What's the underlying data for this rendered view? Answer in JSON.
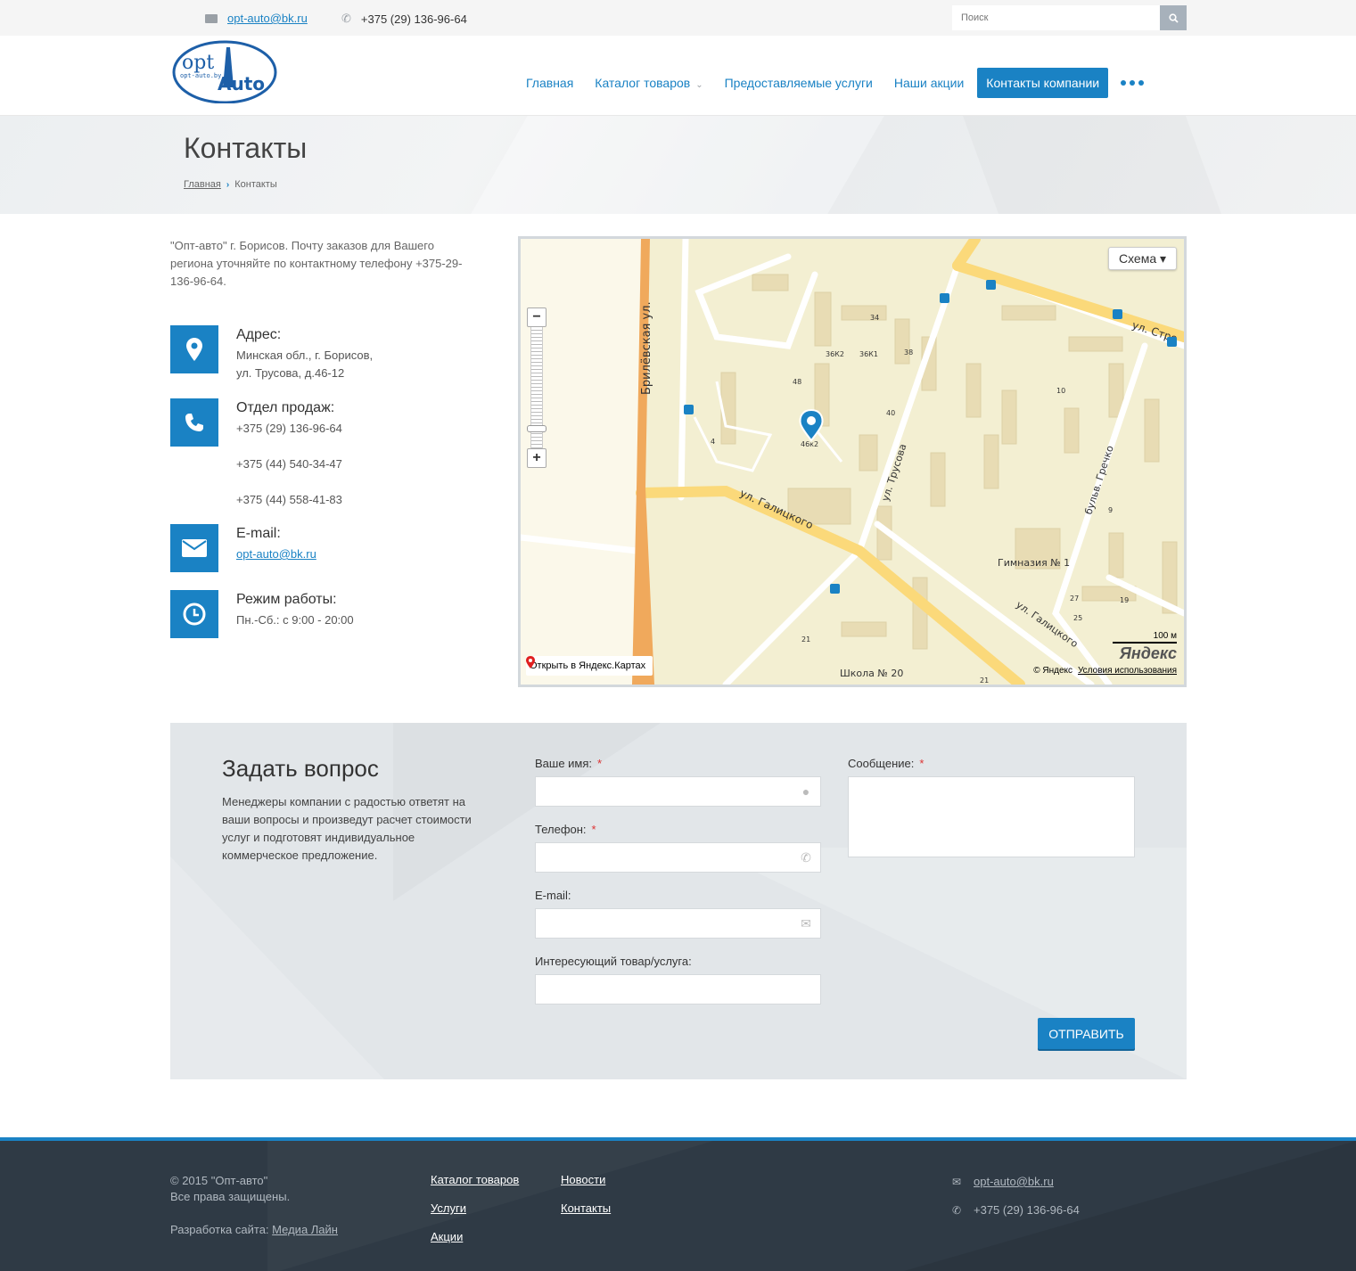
{
  "topbar": {
    "email": "opt-auto@bk.ru",
    "phone": "+375 (29) 136-96-64",
    "search_placeholder": "Поиск"
  },
  "logo": {
    "main": "opt",
    "brand": "Auto",
    "domain": "opt-auto.by"
  },
  "nav": {
    "items": [
      {
        "label": "Главная"
      },
      {
        "label": "Каталог товаров"
      },
      {
        "label": "Предоставляемые услуги"
      },
      {
        "label": "Наши акции"
      },
      {
        "label": "Контакты компании"
      }
    ]
  },
  "page": {
    "title": "Контакты",
    "breadcrumb": [
      "Главная",
      "Контакты"
    ]
  },
  "intro": "\"Опт-авто\" г. Борисов. Почту заказов для Вашего региона уточняйте по контактному телефону +375-29-136-96-64.",
  "contacts": {
    "address": {
      "label": "Адрес:",
      "line1": "Минская обл., г. Борисов,",
      "line2": "ул. Трусова, д.46-12"
    },
    "sales": {
      "label": "Отдел продаж:",
      "phones": [
        "+375 (29) 136-96-64",
        "+375 (44) 540-34-47",
        "+375 (44) 558-41-83"
      ]
    },
    "email": {
      "label": "E-mail:",
      "value": "opt-auto@bk.ru"
    },
    "hours": {
      "label": "Режим работы:",
      "value": "Пн.-Сб.: с 9:00 - 20:00"
    }
  },
  "map": {
    "type_button": "Схема ▾",
    "open_link": "Открыть в Яндекс.Картах",
    "copyright": "© Яндекс",
    "terms": "Условия использования",
    "scale": "100 м",
    "logo": "Яндекс",
    "labels": {
      "street1": "Брилёвская ул.",
      "street2": "ул. Галицкого",
      "street3": "ул. Трусова",
      "street4": "бульв. Гречко",
      "street5": "ул. Галицкого",
      "street6": "ул. Стро",
      "school1": "Гимназия № 1",
      "school2": "Школа № 20",
      "house_marker": "46к2",
      "n34": "34",
      "n36k2": "36К2",
      "n36k1": "36К1",
      "n38": "38",
      "n48": "48",
      "n40": "40",
      "n4": "4",
      "n10": "10",
      "n9": "9",
      "n27": "27",
      "n19": "19",
      "n25": "25",
      "n21": "21",
      "n21b": "21"
    }
  },
  "ask": {
    "title": "Задать вопрос",
    "text": "Менеджеры компании с радостью ответят на ваши вопросы и произведут расчет стоимости услуг и подготовят индивидуальное коммерческое предложение.",
    "name_label": "Ваше имя:",
    "phone_label": "Телефон:",
    "email_label": "E-mail:",
    "product_label": "Интересующий товар/услуга:",
    "message_label": "Сообщение:",
    "required_mark": "*",
    "submit": "ОТПРАВИТЬ"
  },
  "footer": {
    "copyright": "© 2015 \"Опт-авто\"",
    "rights": "Все права защищены.",
    "dev_prefix": "Разработка сайта:",
    "dev_link": "Медиа Лайн",
    "links_col1": [
      "Каталог товаров",
      "Услуги",
      "Акции"
    ],
    "links_col2": [
      "Новости",
      "Контакты"
    ],
    "email": "opt-auto@bk.ru",
    "phone": "+375 (29) 136-96-64"
  },
  "colors": {
    "accent": "#1a82c4",
    "footer_bg": "#2f3a45"
  }
}
